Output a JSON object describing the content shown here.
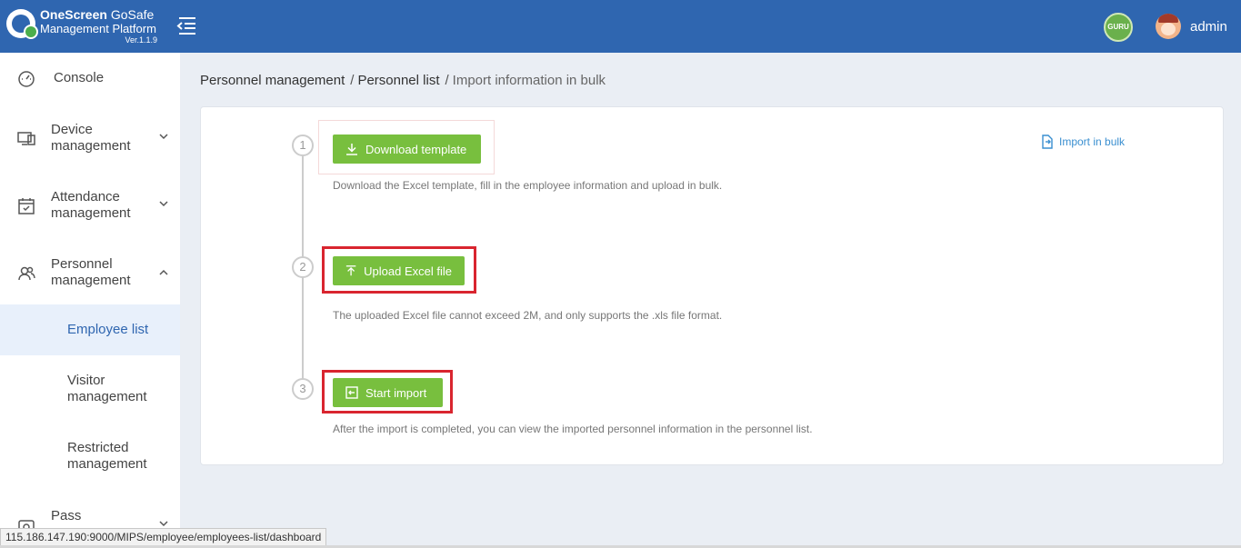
{
  "header": {
    "brand_bold": "OneScreen",
    "brand_rest": " GoSafe",
    "subtitle": "Management Platform",
    "version": "Ver.1.1.9",
    "badge_text": "GURU",
    "username": "admin",
    "brand_color": "#2f66b0"
  },
  "sidebar": {
    "items": [
      {
        "label": "Console",
        "icon": "speedometer-icon"
      },
      {
        "label": "Device management",
        "icon": "devices-icon"
      },
      {
        "label": "Attendance management",
        "icon": "calendar-icon"
      },
      {
        "label": "Personnel management",
        "icon": "people-icon"
      },
      {
        "label": "Pass",
        "icon": "pass-icon"
      }
    ],
    "sub_items": [
      {
        "label": "Employee list",
        "active": true
      },
      {
        "label": "Visitor management",
        "active": false
      },
      {
        "label": "Restricted management",
        "active": false
      }
    ]
  },
  "breadcrumb": {
    "level1": "Personnel management",
    "level2": "Personnel list",
    "current": "Import information in bulk",
    "separator": "/"
  },
  "steps": [
    {
      "number": "1",
      "button": "Download template",
      "description": "Download the Excel template, fill in the employee information and upload in bulk."
    },
    {
      "number": "2",
      "button": "Upload Excel file",
      "description": "The uploaded Excel file cannot exceed 2M, and only supports the .xls file format."
    },
    {
      "number": "3",
      "button": "Start import",
      "description": "After the import is completed, you can view the imported personnel information in the personnel list."
    }
  ],
  "import_bulk_link": "Import in bulk",
  "status_url": "115.186.147.190:9000/MIPS/employee/employees-list/dashboard",
  "colors": {
    "button_green": "#78bf3e",
    "highlight_red": "#d9252f",
    "link_blue": "#3a8fd0"
  }
}
